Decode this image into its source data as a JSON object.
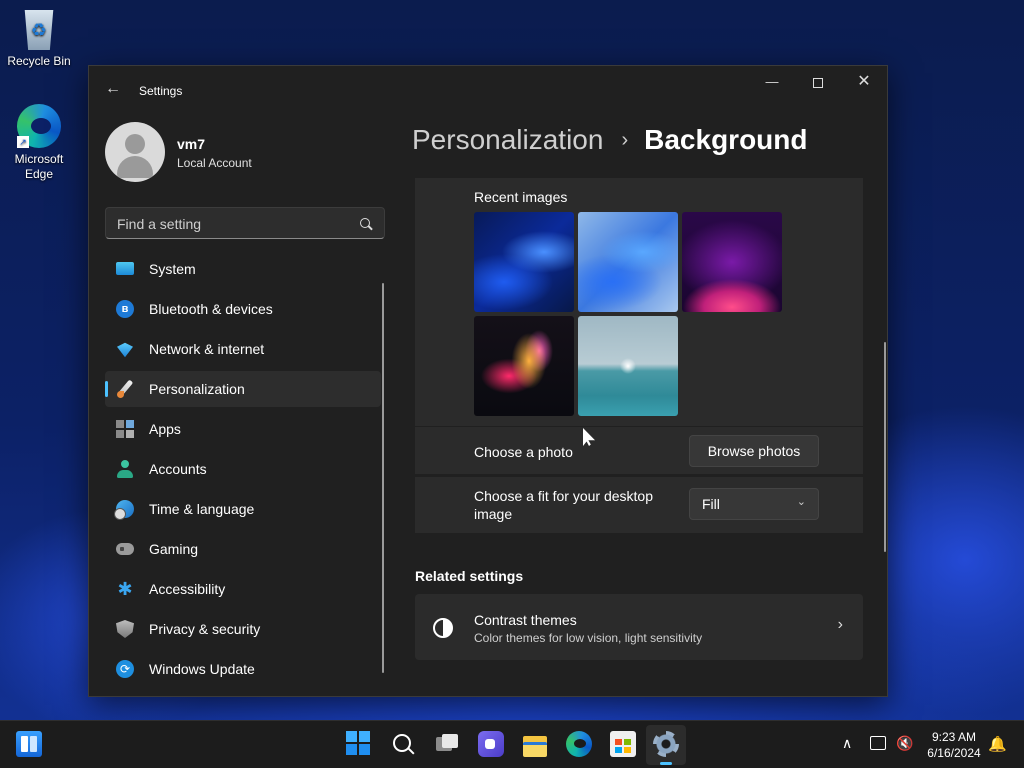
{
  "desktop": {
    "icons": [
      {
        "label": "Recycle Bin"
      },
      {
        "label": "Microsoft Edge"
      }
    ]
  },
  "window": {
    "title": "Settings",
    "back_icon": "back-arrow-icon",
    "controls": {
      "minimize": "—",
      "close": "✕"
    }
  },
  "profile": {
    "name": "vm7",
    "account_type": "Local Account"
  },
  "search": {
    "placeholder": "Find a setting"
  },
  "sidebar": {
    "items": [
      {
        "label": "System",
        "icon": "system-icon"
      },
      {
        "label": "Bluetooth & devices",
        "icon": "bluetooth-icon"
      },
      {
        "label": "Network & internet",
        "icon": "network-icon"
      },
      {
        "label": "Personalization",
        "icon": "paintbrush-icon",
        "active": true
      },
      {
        "label": "Apps",
        "icon": "apps-icon"
      },
      {
        "label": "Accounts",
        "icon": "accounts-icon"
      },
      {
        "label": "Time & language",
        "icon": "time-language-icon"
      },
      {
        "label": "Gaming",
        "icon": "gamepad-icon"
      },
      {
        "label": "Accessibility",
        "icon": "accessibility-icon"
      },
      {
        "label": "Privacy & security",
        "icon": "shield-icon"
      },
      {
        "label": "Windows Update",
        "icon": "update-icon"
      }
    ]
  },
  "breadcrumb": {
    "parent": "Personalization",
    "separator": "›",
    "current": "Background"
  },
  "recent_images": {
    "label": "Recent images",
    "images": [
      {
        "name": "blue-bloom-dark"
      },
      {
        "name": "blue-bloom-light"
      },
      {
        "name": "purple-glow"
      },
      {
        "name": "colorful-ribbon"
      },
      {
        "name": "lake-sunrise"
      }
    ]
  },
  "choose_photo": {
    "label": "Choose a photo",
    "button": "Browse photos"
  },
  "choose_fit": {
    "label": "Choose a fit for your desktop image",
    "selected": "Fill",
    "chevron": "⌄"
  },
  "related": {
    "title": "Related settings",
    "items": [
      {
        "title": "Contrast themes",
        "subtitle": "Color themes for low vision, light sensitivity",
        "arrow": "›"
      }
    ]
  },
  "taskbar": {
    "apps": [
      "widgets",
      "start",
      "search",
      "task-view",
      "chat",
      "file-explorer",
      "edge",
      "store",
      "settings"
    ],
    "tray": {
      "chevron": "∧",
      "volume": "🔇",
      "time": "9:23 AM",
      "date": "6/16/2024",
      "notification": "🔔"
    }
  },
  "colors": {
    "accent": "#4cc2ff",
    "window_bg": "#202020",
    "card_bg": "#2b2b2b"
  }
}
